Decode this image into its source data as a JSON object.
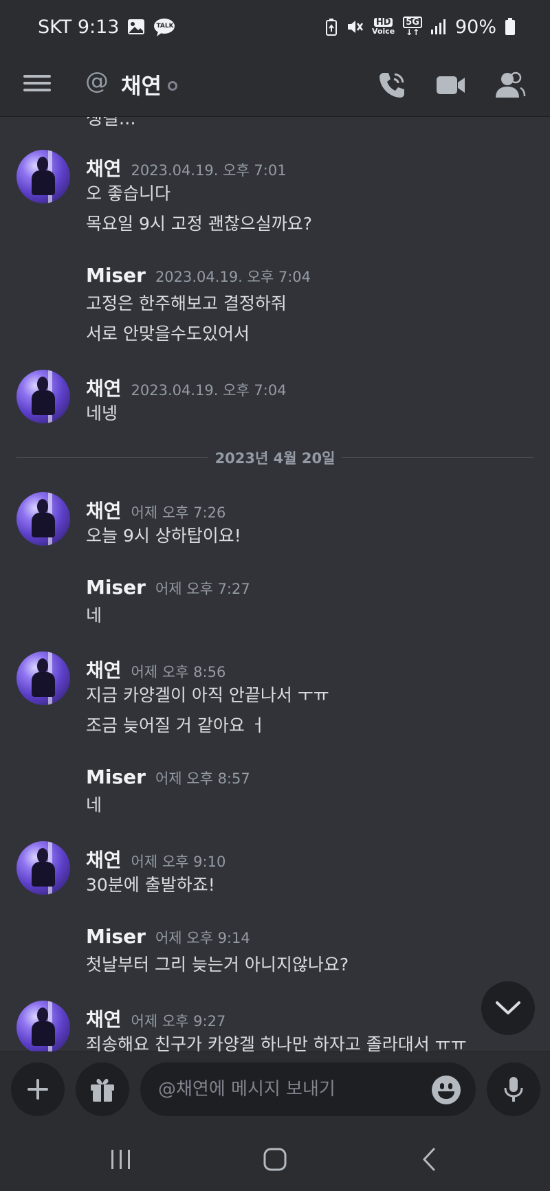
{
  "status_bar": {
    "carrier_time": "SKT 9:13",
    "talk_badge": "TALK",
    "hd_voice_top": "HD",
    "hd_voice_bottom": "Voice",
    "network": "5G",
    "battery": "90%"
  },
  "header": {
    "at_symbol": "@",
    "channel_name": "채연"
  },
  "messages": {
    "cutoff_text": "생길..."
  },
  "groups": [
    {
      "author": "채연",
      "timestamp": "2023.04.19. 오후 7:01",
      "lines": [
        "오 좋습니다",
        "목요일 9시 고정 괜찮으실까요?"
      ]
    },
    {
      "author": "Miser",
      "timestamp": "2023.04.19. 오후 7:04",
      "lines": [
        "고정은 한주해보고 결정하줘",
        "서로 안맞을수도있어서"
      ]
    },
    {
      "author": "채연",
      "timestamp": "2023.04.19. 오후 7:04",
      "lines": [
        "네넹"
      ]
    },
    {
      "author": "채연",
      "timestamp": "어제 오후 7:26",
      "lines": [
        "오늘 9시 상하탑이요!"
      ]
    },
    {
      "author": "Miser",
      "timestamp": "어제 오후 7:27",
      "lines": [
        "네"
      ]
    },
    {
      "author": "채연",
      "timestamp": "어제 오후 8:56",
      "lines": [
        "지금 카양겔이 아직 안끝나서 ㅜㅠ",
        "조금 늦어질 거 같아요 ㅓ"
      ]
    },
    {
      "author": "Miser",
      "timestamp": "어제 오후 8:57",
      "lines": [
        "네"
      ]
    },
    {
      "author": "채연",
      "timestamp": "어제 오후 9:10",
      "lines": [
        "30분에 출발하죠!"
      ]
    },
    {
      "author": "Miser",
      "timestamp": "어제 오후 9:14",
      "lines": [
        "첫날부터 그리 늦는거 아니지않나요?"
      ]
    },
    {
      "author": "채연",
      "timestamp": "어제 오후 9:27",
      "lines": [
        "죄송해요 친구가 카양겔 하나만 하자고 졸라대서 ㅠㅠ"
      ]
    }
  ],
  "date_divider": "2023년 4월 20일",
  "composer": {
    "placeholder": "@채연에 메시지 보내기"
  },
  "colors": {
    "background": "#313338",
    "header": "#2b2d31",
    "input": "#1e1f22",
    "muted_text": "#949ba4",
    "avatar_purple": "#8f74f0"
  },
  "icons": [
    "menu-icon",
    "at-icon",
    "phone-call-icon",
    "video-camera-icon",
    "members-icon",
    "chevron-down-icon",
    "plus-icon",
    "gift-icon",
    "emoji-icon",
    "microphone-icon",
    "recent-apps-icon",
    "home-icon",
    "back-icon"
  ]
}
